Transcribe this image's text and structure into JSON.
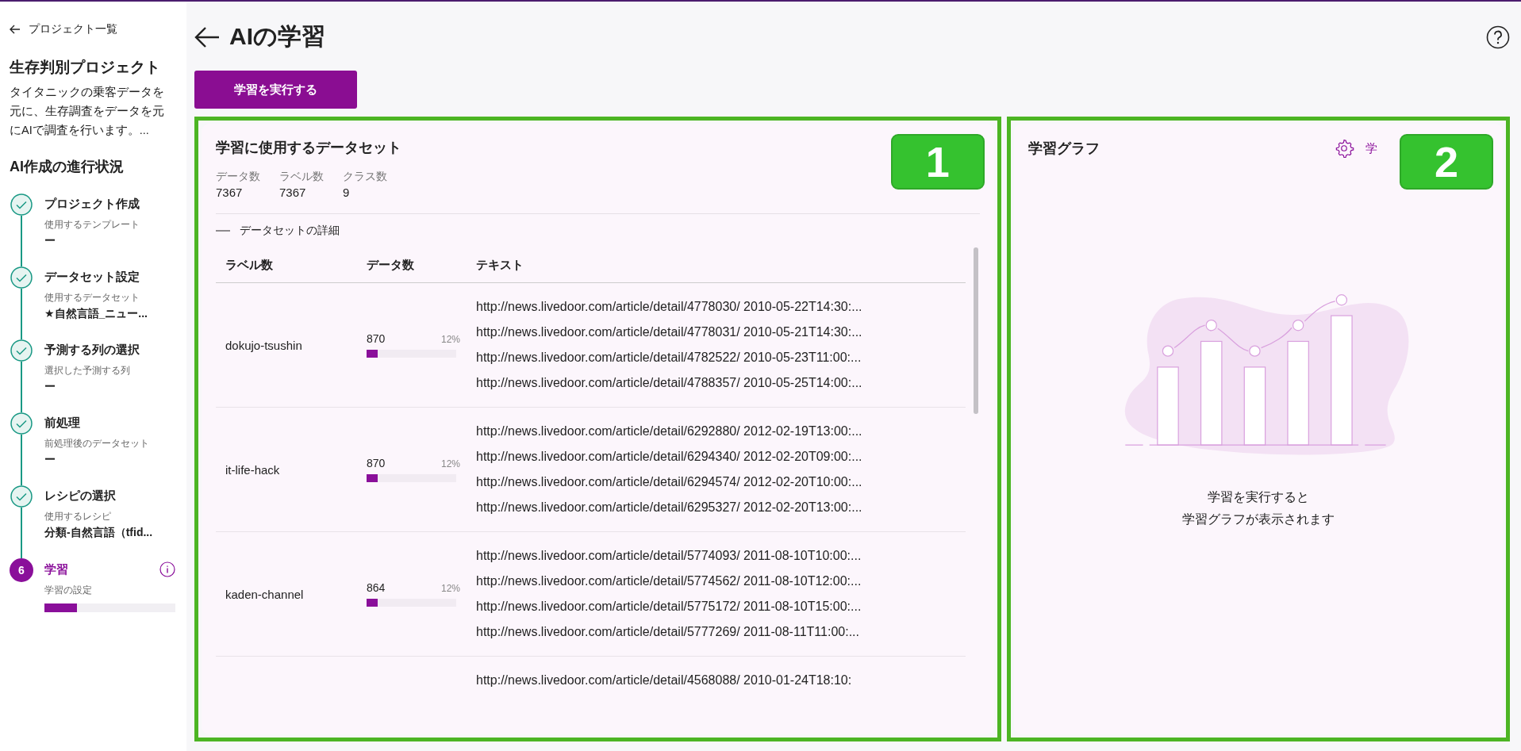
{
  "sidebar": {
    "back_link": "プロジェクト一覧",
    "project_title": "生存判別プロジェクト",
    "project_description": "タイタニックの乗客データを元に、生存調査をデータを元にAIで調査を行います。...",
    "progress_heading": "AI作成の進行状況",
    "steps": [
      {
        "done": true,
        "title": "プロジェクト作成",
        "sublabel": "使用するテンプレート",
        "value": "ー"
      },
      {
        "done": true,
        "title": "データセット設定",
        "sublabel": "使用するデータセット",
        "value": "★自然言語_ニュー..."
      },
      {
        "done": true,
        "title": "予測する列の選択",
        "sublabel": "選択した予測する列",
        "value": "ー"
      },
      {
        "done": true,
        "title": "前処理",
        "sublabel": "前処理後のデータセット",
        "value": "ー"
      },
      {
        "done": true,
        "title": "レシピの選択",
        "sublabel": "使用するレシピ",
        "value": "分類-自然言語（tfid..."
      },
      {
        "done": false,
        "number": "6",
        "title": "学習",
        "sublabel": "学習の設定",
        "level": 0.25
      }
    ]
  },
  "page_title": "AIの学習",
  "run_button": "学習を実行する",
  "dataset_panel": {
    "annotation": "1",
    "title": "学習に使用するデータセット",
    "stats": [
      {
        "label": "データ数",
        "value": "7367"
      },
      {
        "label": "ラベル数",
        "value": "7367"
      },
      {
        "label": "クラス数",
        "value": "9"
      }
    ],
    "details_toggle": "データセットの詳細",
    "expanded": true,
    "table": {
      "columns": [
        "ラベル数",
        "データ数",
        "テキスト"
      ],
      "rows": [
        {
          "label": "dokujo-tsushin",
          "count": "870",
          "percent": "12%",
          "level": 0.12,
          "texts": [
            "http://news.livedoor.com/article/detail/4778030/ 2010-05-22T14:30:...",
            "http://news.livedoor.com/article/detail/4778031/ 2010-05-21T14:30:...",
            "http://news.livedoor.com/article/detail/4782522/ 2010-05-23T11:00:...",
            "http://news.livedoor.com/article/detail/4788357/ 2010-05-25T14:00:..."
          ]
        },
        {
          "label": "it-life-hack",
          "count": "870",
          "percent": "12%",
          "level": 0.12,
          "texts": [
            "http://news.livedoor.com/article/detail/6292880/ 2012-02-19T13:00:...",
            "http://news.livedoor.com/article/detail/6294340/ 2012-02-20T09:00:...",
            "http://news.livedoor.com/article/detail/6294574/ 2012-02-20T10:00:...",
            "http://news.livedoor.com/article/detail/6295327/ 2012-02-20T13:00:..."
          ]
        },
        {
          "label": "kaden-channel",
          "count": "864",
          "percent": "12%",
          "level": 0.12,
          "texts": [
            "http://news.livedoor.com/article/detail/5774093/ 2011-08-10T10:00:...",
            "http://news.livedoor.com/article/detail/5774562/ 2011-08-10T12:00:...",
            "http://news.livedoor.com/article/detail/5775172/ 2011-08-10T15:00:...",
            "http://news.livedoor.com/article/detail/5777269/ 2011-08-11T11:00:..."
          ]
        },
        {
          "texts": [
            "http://news.livedoor.com/article/detail/4568088/ 2010-01-24T18:10:"
          ]
        }
      ]
    }
  },
  "graph_panel": {
    "annotation": "2",
    "title": "学習グラフ",
    "settings_link": "学",
    "empty_message": [
      "学習を実行すると",
      "学習グラフが表示されます"
    ]
  }
}
